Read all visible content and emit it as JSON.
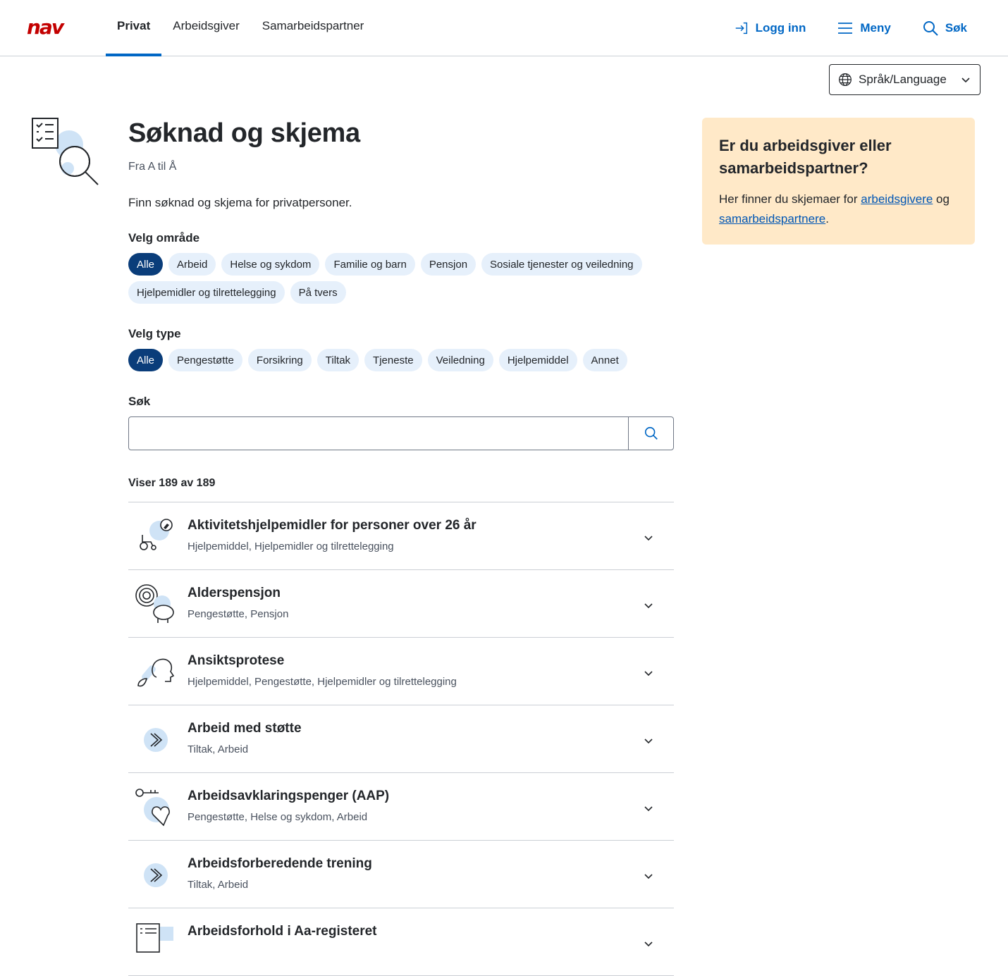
{
  "header": {
    "logo": "nav",
    "tabs": [
      {
        "label": "Privat",
        "active": true
      },
      {
        "label": "Arbeidsgiver",
        "active": false
      },
      {
        "label": "Samarbeidspartner",
        "active": false
      }
    ],
    "login_label": "Logg inn",
    "menu_label": "Meny",
    "search_label": "Søk"
  },
  "language": {
    "label": "Språk/Language"
  },
  "page": {
    "title": "Søknad og skjema",
    "subtitle": "Fra A til Å",
    "intro": "Finn søknad og skjema for privatpersoner."
  },
  "filters": {
    "area_label": "Velg område",
    "areas": [
      {
        "label": "Alle",
        "active": true
      },
      {
        "label": "Arbeid",
        "active": false
      },
      {
        "label": "Helse og sykdom",
        "active": false
      },
      {
        "label": "Familie og barn",
        "active": false
      },
      {
        "label": "Pensjon",
        "active": false
      },
      {
        "label": "Sosiale tjenester og veiledning",
        "active": false
      },
      {
        "label": "Hjelpemidler og tilrettelegging",
        "active": false
      },
      {
        "label": "På tvers",
        "active": false
      }
    ],
    "type_label": "Velg type",
    "types": [
      {
        "label": "Alle",
        "active": true
      },
      {
        "label": "Pengestøtte",
        "active": false
      },
      {
        "label": "Forsikring",
        "active": false
      },
      {
        "label": "Tiltak",
        "active": false
      },
      {
        "label": "Tjeneste",
        "active": false
      },
      {
        "label": "Veiledning",
        "active": false
      },
      {
        "label": "Hjelpemiddel",
        "active": false
      },
      {
        "label": "Annet",
        "active": false
      }
    ]
  },
  "search": {
    "label": "Søk",
    "value": "",
    "placeholder": ""
  },
  "results": {
    "count_text": "Viser 189 av 189",
    "items": [
      {
        "name": "Aktivitetshjelpemidler for personer over 26 år",
        "tags": "Hjelpemiddel, Hjelpemidler og tilrettelegging",
        "icon": "wheelchair-compass-icon"
      },
      {
        "name": "Alderspensjon",
        "tags": "Pengestøtte, Pensjon",
        "icon": "piggybank-icon"
      },
      {
        "name": "Ansiktsprotese",
        "tags": "Hjelpemiddel, Pengestøtte, Hjelpemidler og tilrettelegging",
        "icon": "face-profile-icon"
      },
      {
        "name": "Arbeid med støtte",
        "tags": "Tiltak, Arbeid",
        "icon": "chevron-circle-icon"
      },
      {
        "name": "Arbeidsavklaringspenger (AAP)",
        "tags": "Pengestøtte, Helse og sykdom, Arbeid",
        "icon": "key-heart-icon"
      },
      {
        "name": "Arbeidsforberedende trening",
        "tags": "Tiltak, Arbeid",
        "icon": "chevron-circle-icon"
      },
      {
        "name": "Arbeidsforhold i Aa-registeret",
        "tags": "",
        "icon": "document-list-icon"
      }
    ]
  },
  "side_panel": {
    "heading": "Er du arbeidsgiver eller samarbeidspartner?",
    "text_before": "Her finner du skjemaer for ",
    "link1": "arbeidsgivere",
    "text_middle": " og ",
    "link2": "samarbeidspartnere",
    "text_after": "."
  },
  "colors": {
    "accent": "#0067c5",
    "chip_active": "#0a3d7a",
    "chip": "#e6f0fb",
    "panel": "#ffe9c8",
    "logo": "#c30000"
  }
}
